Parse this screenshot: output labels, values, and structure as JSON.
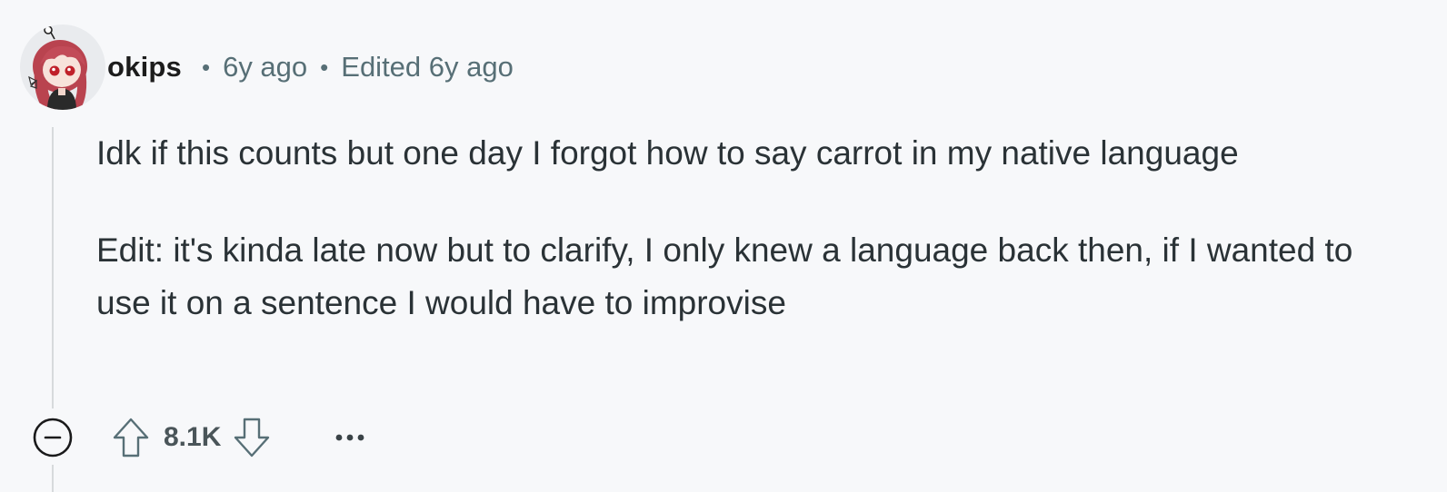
{
  "comment": {
    "username": "okips",
    "separator": "•",
    "age": "6y ago",
    "edited": "Edited 6y ago",
    "paragraphs": [
      "Idk if this counts but one day I forgot how to say carrot in my native language",
      "Edit: it's kinda late now but to clarify, I only knew a language back then, if I wanted to use it on a sentence I would have to improvise"
    ],
    "score": "8.1K"
  },
  "icons": {
    "avatar": "user-avatar",
    "collapse": "collapse-minus-icon",
    "upvote": "arrow-up-icon",
    "downvote": "arrow-down-icon",
    "more": "more-horizontal-icon"
  },
  "colors": {
    "background": "#f7f8fa",
    "meta_text": "#576f76",
    "body_text": "#2a3236",
    "thread_line": "#d7dadc"
  }
}
